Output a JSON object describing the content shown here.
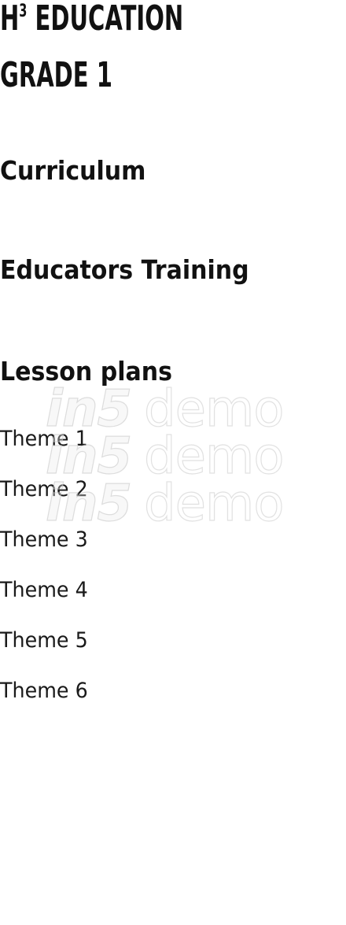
{
  "header": {
    "title_line1": "H",
    "title_superscript": "3",
    "title_line1_rest": " Education",
    "title_line2": "Grade 1"
  },
  "sections": {
    "curriculum": "Curriculum",
    "educators_training": "Educators Training",
    "lesson_plans": "Lesson plans"
  },
  "themes": [
    "Theme 1",
    "Theme 2",
    "Theme 3",
    "Theme 4",
    "Theme 5",
    "Theme 6"
  ],
  "watermark": {
    "brand": "in5",
    "word": "demo"
  },
  "colors": {
    "text": "#111111",
    "background": "#ffffff"
  }
}
